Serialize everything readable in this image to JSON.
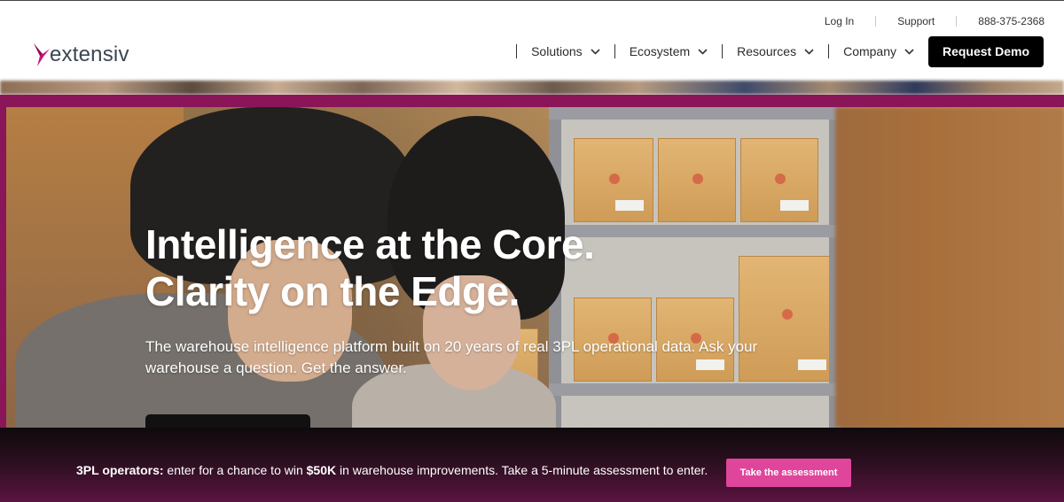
{
  "brand": {
    "logo_text": "extensiv",
    "accent_color": "#c4177a",
    "banner_button_color": "#e0459c"
  },
  "utility_nav": {
    "items": [
      {
        "label": "Log In"
      },
      {
        "label": "Support"
      },
      {
        "label": "888-375-2368"
      }
    ]
  },
  "main_nav": {
    "items": [
      {
        "label": "Solutions",
        "icon": "chevron-down-icon"
      },
      {
        "label": "Ecosystem",
        "icon": "chevron-down-icon"
      },
      {
        "label": "Resources",
        "icon": "chevron-down-icon"
      },
      {
        "label": "Company",
        "icon": "chevron-down-icon"
      }
    ],
    "cta_label": "Request Demo"
  },
  "hero": {
    "title_line1": "Intelligence at the Core.",
    "title_line2": "Clarity on the Edge.",
    "subtitle": "The warehouse intelligence platform built on 20 years of real 3PL operational data. Ask your warehouse a question. Get the answer."
  },
  "banner": {
    "bold_lead": "3PL operators:",
    "text_part1": " enter for a chance to win ",
    "bold_amount": "$50K",
    "text_part2": " in warehouse improvements. Take a 5-minute assessment to enter.",
    "button_label": "Take the assessment"
  }
}
